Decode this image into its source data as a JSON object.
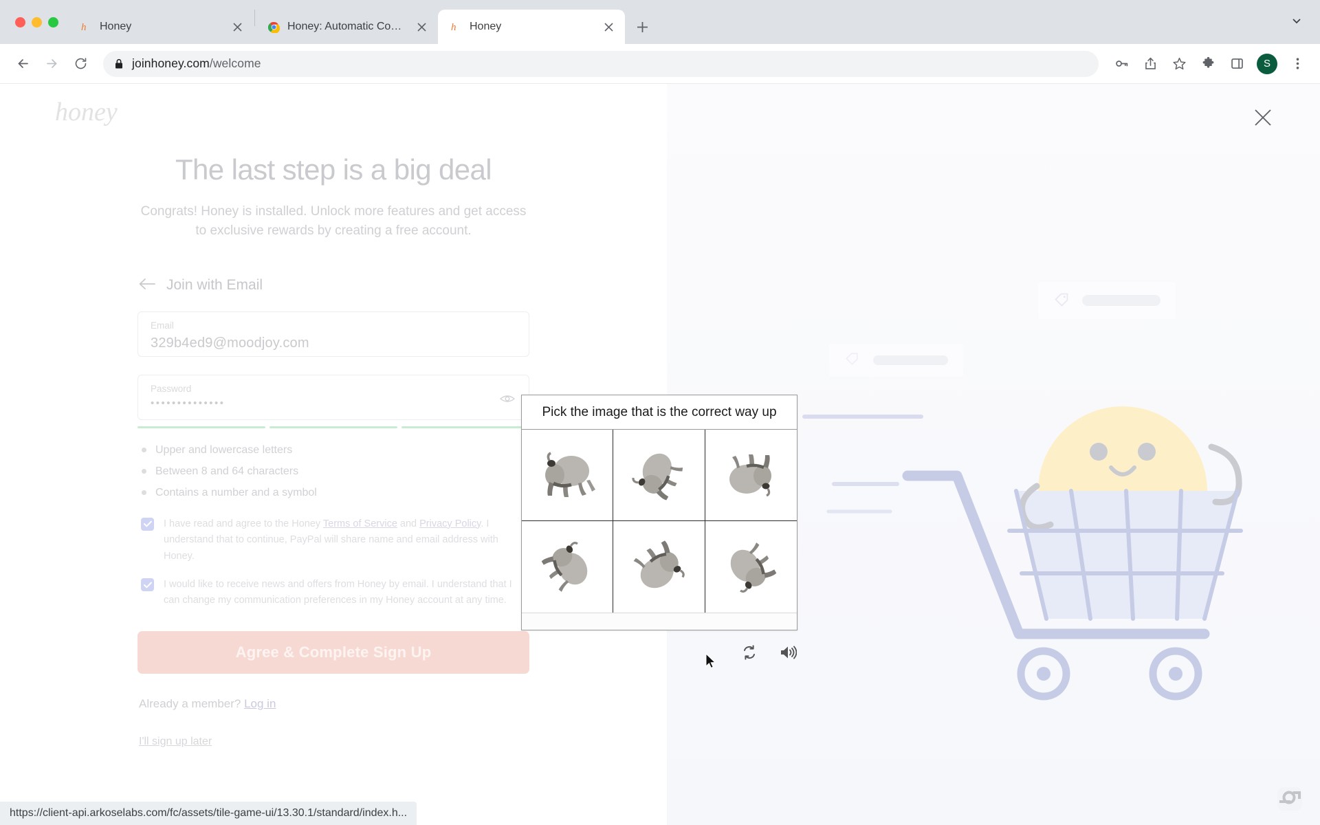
{
  "browser": {
    "traffic_lights": [
      "close",
      "minimize",
      "maximize"
    ],
    "tabs": [
      {
        "title": "Honey",
        "favicon": "honey-icon",
        "active": false
      },
      {
        "title": "Honey: Automatic Coupons & C",
        "favicon": "chrome-icon",
        "active": false
      },
      {
        "title": "Honey",
        "favicon": "honey-icon",
        "active": true
      }
    ],
    "new_tab_label": "+",
    "tab_list_chevron": "chevron-down-icon",
    "toolbar": {
      "back": "back-arrow-icon",
      "forward": "forward-arrow-icon",
      "reload": "reload-icon",
      "lock": "lock-icon",
      "url_host": "joinhoney.com",
      "url_path": "/welcome",
      "icons": [
        "key-icon",
        "share-icon",
        "star-icon",
        "extensions-icon",
        "side-panel-icon"
      ],
      "profile_initial": "S",
      "menu": "three-dot-menu-icon"
    },
    "status_url": "https://client-api.arkoselabs.com/fc/assets/tile-game-ui/13.30.1/standard/index.h..."
  },
  "page": {
    "logo_text": "honey",
    "close_label": "×",
    "headline": "The last step is a big deal",
    "subhead": "Congrats! Honey is installed. Unlock more features and get access to exclusive rewards by creating a free account.",
    "join_label": "Join with Email",
    "back_arrow": "←",
    "email_field": {
      "label": "Email",
      "value": "329b4ed9@moodjoy.com"
    },
    "password_field": {
      "label": "Password",
      "value": "••••••••••••••",
      "toggle_icon": "eye-icon"
    },
    "password_strength": {
      "segments": 3,
      "filled": 3,
      "color": "#c8ecd2"
    },
    "requirements": [
      "Upper and lowercase letters",
      "Between 8 and 64 characters",
      "Contains a number and a symbol"
    ],
    "consents": [
      {
        "checked": true,
        "text_1": "I have read and agree to the Honey ",
        "link_1": "Terms of Service",
        "text_2": " and ",
        "link_2": "Privacy Policy",
        "text_3": ". I understand that to continue, PayPal will share name and email address with Honey."
      },
      {
        "checked": true,
        "text_1": "I would like to receive news and offers from Honey by email. I understand that I can change my communication preferences in my Honey account at any time.",
        "link_1": "",
        "text_2": "",
        "link_2": "",
        "text_3": ""
      }
    ],
    "cta_label": "Agree & Complete Sign Up",
    "member_prompt": "Already a member?",
    "login_link": "Log in",
    "later_link": "I'll sign up later"
  },
  "captcha": {
    "prompt": "Pick the image that is the correct way up",
    "tiles": [
      {
        "index": 1,
        "subject": "bison",
        "rotation_deg": 0
      },
      {
        "index": 2,
        "subject": "bison",
        "rotation_deg": 300
      },
      {
        "index": 3,
        "subject": "bison",
        "rotation_deg": 180
      },
      {
        "index": 4,
        "subject": "bison",
        "rotation_deg": 60
      },
      {
        "index": 5,
        "subject": "bison",
        "rotation_deg": 150
      },
      {
        "index": 6,
        "subject": "bison",
        "rotation_deg": 240
      }
    ],
    "controls": [
      {
        "name": "refresh-icon",
        "label": "Reload challenge"
      },
      {
        "name": "audio-icon",
        "label": "Audio challenge"
      }
    ]
  },
  "illustration": {
    "mascot": "honey-jar-face",
    "cart": "shopping-cart",
    "ghost_cards": [
      {
        "tag": "price-tag-icon"
      },
      {
        "tag": "price-tag-icon"
      },
      {
        "tag": "price-tag-icon"
      }
    ]
  },
  "colors": {
    "accent_pink": "#f7d9d4",
    "mascot_yellow": "#fdf0c9",
    "cart_blue": "#c6cbe6",
    "checkbox_blue": "#cfd4f5",
    "strength_green": "#c8ecd2",
    "profile_green": "#0b5c3f"
  }
}
